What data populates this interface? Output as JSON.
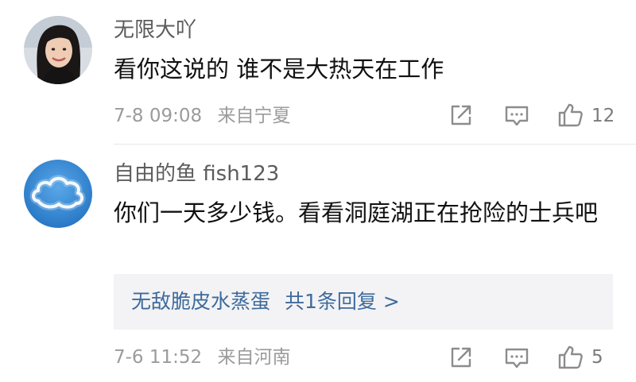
{
  "comments": [
    {
      "username": "无限大吖",
      "content": "看你这说的 谁不是大热天在工作",
      "time": "7-8 09:08",
      "location": "来自宁夏",
      "like_count": "12",
      "avatar_icon": "portrait-avatar",
      "reply": null
    },
    {
      "username": "自由的鱼 fish123",
      "content": "你们一天多少钱。看看洞庭湖正在抢险的士兵吧",
      "time": "7-6 11:52",
      "location": "来自河南",
      "like_count": "5",
      "avatar_icon": "cloud-sky-avatar",
      "reply": {
        "author": "无敌脆皮水蒸蛋",
        "summary": "共1条回复 >"
      }
    }
  ],
  "colors": {
    "username": "#5c5c5c",
    "content": "#111111",
    "meta": "#9b9b9b",
    "reply_link": "#3e6b9c",
    "reply_bg": "#f3f3f5",
    "icon": "#8c8c8c"
  },
  "icons": {
    "share": "share-icon",
    "reply": "reply-icon",
    "like": "thumbs-up-icon"
  }
}
